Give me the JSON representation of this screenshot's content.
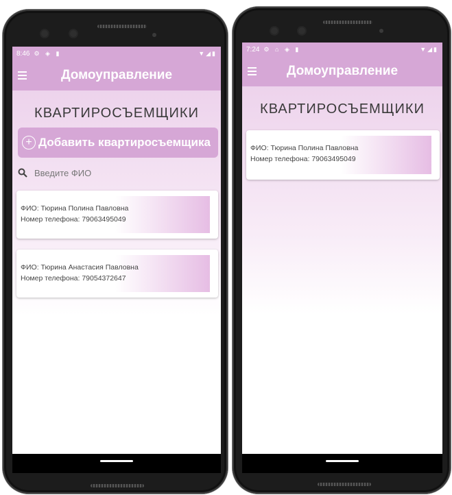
{
  "left_phone": {
    "status": {
      "time": "8:46",
      "icons": "⚙ ◈ ▮",
      "right": "▼◢▮"
    },
    "appbar": {
      "title": "Домоуправление"
    },
    "page_title": "КВАРТИРОСЪЕМЩИКИ",
    "add_button": {
      "label": "Добавить квартиросъемщика"
    },
    "search": {
      "placeholder": "Введите ФИО"
    },
    "tenants": [
      {
        "name": "ФИО: Тюрина Полина Павловна",
        "phone": "Номер телефона: 79063495049"
      },
      {
        "name": "ФИО: Тюрина Анастасия Павловна",
        "phone": "Номер телефона: 79054372647"
      }
    ]
  },
  "right_phone": {
    "status": {
      "time": "7:24",
      "icons": "⚙ ⌂ ◈ ▮",
      "right": "▼◢▮"
    },
    "appbar": {
      "title": "Домоуправление"
    },
    "page_title": "КВАРТИРОСЪЕМЩИКИ",
    "tenants": [
      {
        "name": "ФИО: Тюрина Полина Павловна",
        "phone": "Номер телефона: 79063495049"
      }
    ]
  }
}
